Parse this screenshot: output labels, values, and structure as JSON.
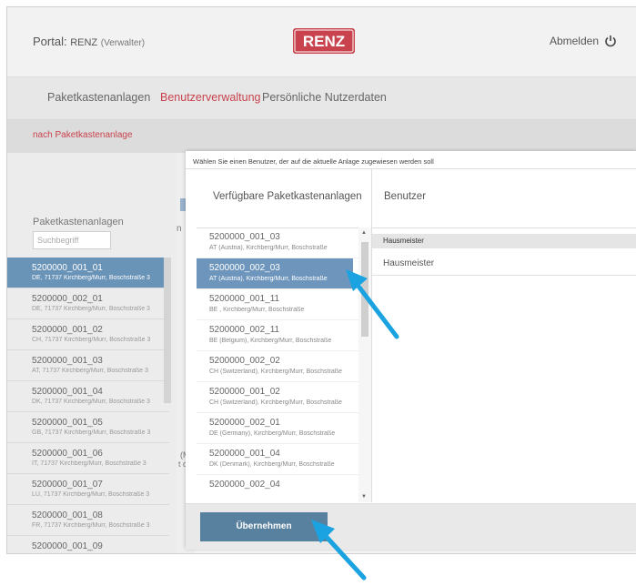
{
  "header": {
    "portal_label": "Portal:",
    "portal_name": "RENZ",
    "portal_role": "(Verwalter)",
    "logo_text": "RENZ",
    "logout_label": "Abmelden"
  },
  "nav": {
    "tabs": [
      {
        "label": "Paketkastenanlagen"
      },
      {
        "label": "Benutzerverwaltung"
      },
      {
        "label": "Persönliche Nutzerdaten"
      }
    ],
    "sub_link": "nach Paketkastenanlage"
  },
  "background_list": {
    "title": "Paketkastenanlagen",
    "search_placeholder": "Suchbegriff",
    "items": [
      {
        "code": "5200000_001_01",
        "addr": "DE, 71737 Kirchberg/Murr, Boschstraße 3"
      },
      {
        "code": "5200000_002_01",
        "addr": "DE, 71737 Kirchberg/Murr, Boschstraße 3"
      },
      {
        "code": "5200000_001_02",
        "addr": "CH, 71737 Kirchberg/Murr, Boschstraße 3"
      },
      {
        "code": "5200000_001_03",
        "addr": "AT, 71737 Kirchberg/Murr, Boschstraße 3"
      },
      {
        "code": "5200000_001_04",
        "addr": "DK, 71737 Kirchberg/Murr, Boschstraße 3"
      },
      {
        "code": "5200000_001_05",
        "addr": "GB, 71737 Kirchberg/Murr, Boschstraße 3"
      },
      {
        "code": "5200000_001_06",
        "addr": "IT, 71737 Kirchberg/Murr, Boschstraße 3"
      },
      {
        "code": "5200000_001_07",
        "addr": "LU, 71737 Kirchberg/Murr, Boschstraße 3"
      },
      {
        "code": "5200000_001_08",
        "addr": "FR, 71737 Kirchberg/Murr, Boschstraße 3"
      },
      {
        "code": "5200000_001_09",
        "addr": ""
      }
    ],
    "fragment_n": "n",
    "fragment_m": "(M",
    "fragment_td": "t d"
  },
  "dialog": {
    "title": "Wählen Sie einen Benutzer, der auf die aktuelle Anlage zugewiesen werden soll",
    "left_header": "Verfügbare Paketkastenanlagen",
    "right_header": "Benutzer",
    "items": [
      {
        "code": "5200000_001_03",
        "addr": "AT (Austria), Kirchberg/Murr, Boschstraße"
      },
      {
        "code": "5200000_002_03",
        "addr": "AT (Austria), Kirchberg/Murr, Boschstraße"
      },
      {
        "code": "5200000_001_11",
        "addr": "BE , Kirchberg/Murr, Boschstraße"
      },
      {
        "code": "5200000_002_11",
        "addr": "BE (Belgium), Kirchberg/Murr, Boschstraße"
      },
      {
        "code": "5200000_002_02",
        "addr": "CH (Switzerland), Kirchberg/Murr, Boschstraße"
      },
      {
        "code": "5200000_001_02",
        "addr": "CH (Switzerland), Kirchberg/Murr, Boschstraße"
      },
      {
        "code": "5200000_002_01",
        "addr": "DE (Germany), Kirchberg/Murr, Boschstraße"
      },
      {
        "code": "5200000_001_04",
        "addr": "DK (Denmark), Kirchberg/Murr, Boschstraße"
      },
      {
        "code": "5200000_002_04",
        "addr": ""
      }
    ],
    "group_header": "Hausmeister",
    "user": "Hausmeister",
    "submit_label": "Übernehmen"
  },
  "icons": {
    "logout": "power-icon",
    "pointer": "arrow-pointer-icon"
  },
  "colors": {
    "accent_red": "#c8434d",
    "selection_blue": "#6e96bd",
    "button_blue": "#58809f",
    "arrow_cyan": "#1aa3e0"
  }
}
